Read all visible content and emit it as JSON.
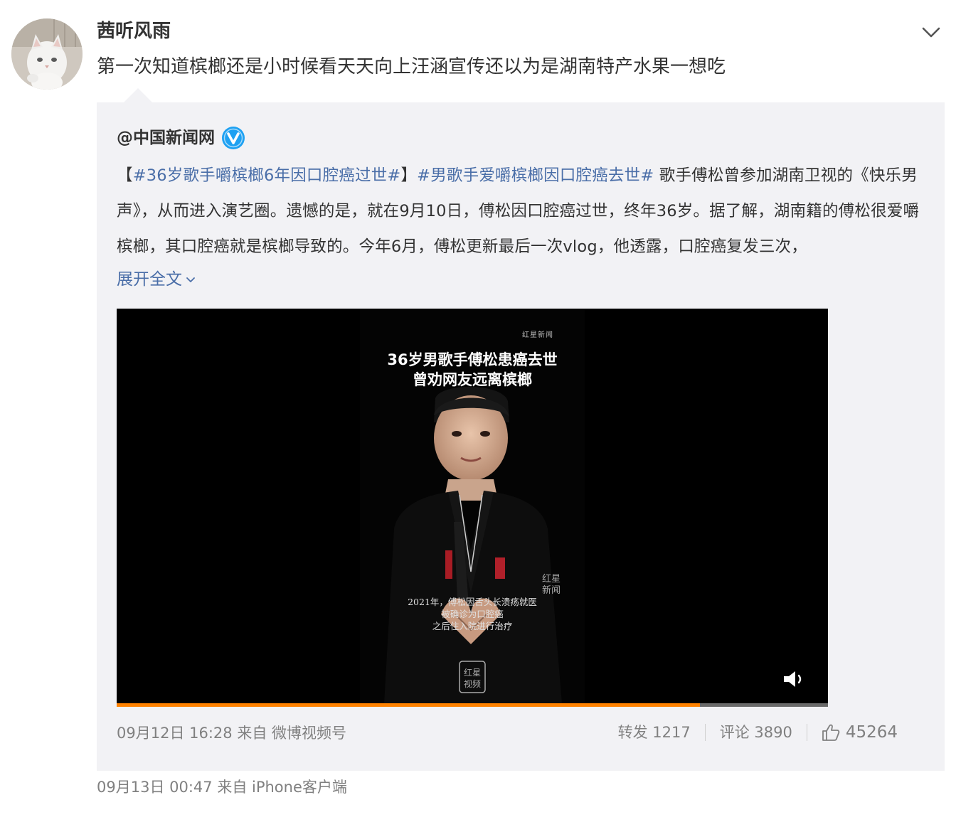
{
  "post": {
    "username": "茜听风雨",
    "text": "第一次知道槟榔还是小时候看天天向上汪涵宣传还以为是湖南特产水果一想吃",
    "time": "09月13日 00:47",
    "source": "来自 iPhone客户端"
  },
  "repost": {
    "author": "@中国新闻网",
    "verified": true,
    "bracket_open": "【",
    "topic1": "#36岁歌手嚼槟榔6年因口腔癌过世#",
    "bracket_close": "】",
    "topic2": "#男歌手爱嚼槟榔因口腔癌去世#",
    "body": " 歌手傅松曾参加湖南卫视的《快乐男声》，从而进入演艺圈。遗憾的是，就在9月10日，傅松因口腔癌过世，终年36岁。据了解，湖南籍的傅松很爱嚼槟榔，其口腔癌就是槟榔导致的。今年6月，傅松更新最后一次vlog，他透露，口腔癌复发三次，",
    "expand_label": "展开全文",
    "video": {
      "logo_text": "红星新闻",
      "title_line1": "36岁男歌手傅松患癌去世",
      "title_line2": "曾劝网友远离槟榔",
      "caption_line1": "2021年，傅松因舌头长溃疡就医",
      "caption_line2": "被确诊为口腔癌",
      "caption_line3": "之后住入院进行治疗",
      "progress": 0.82
    },
    "time": "09月12日 16:28",
    "source": "来自 微博视频号",
    "reposts_label": "转发 1217",
    "comments_label": "评论 3890",
    "likes": "45264"
  },
  "colors": {
    "link": "#4a6ea8",
    "verified": "#1ea1f2",
    "progress": "#ff8200",
    "repost_bg": "#f2f2f5"
  },
  "icons": [
    "chevron-down-icon",
    "verified-icon",
    "chevron-small-down-icon",
    "volume-icon",
    "thumbs-up-icon"
  ]
}
